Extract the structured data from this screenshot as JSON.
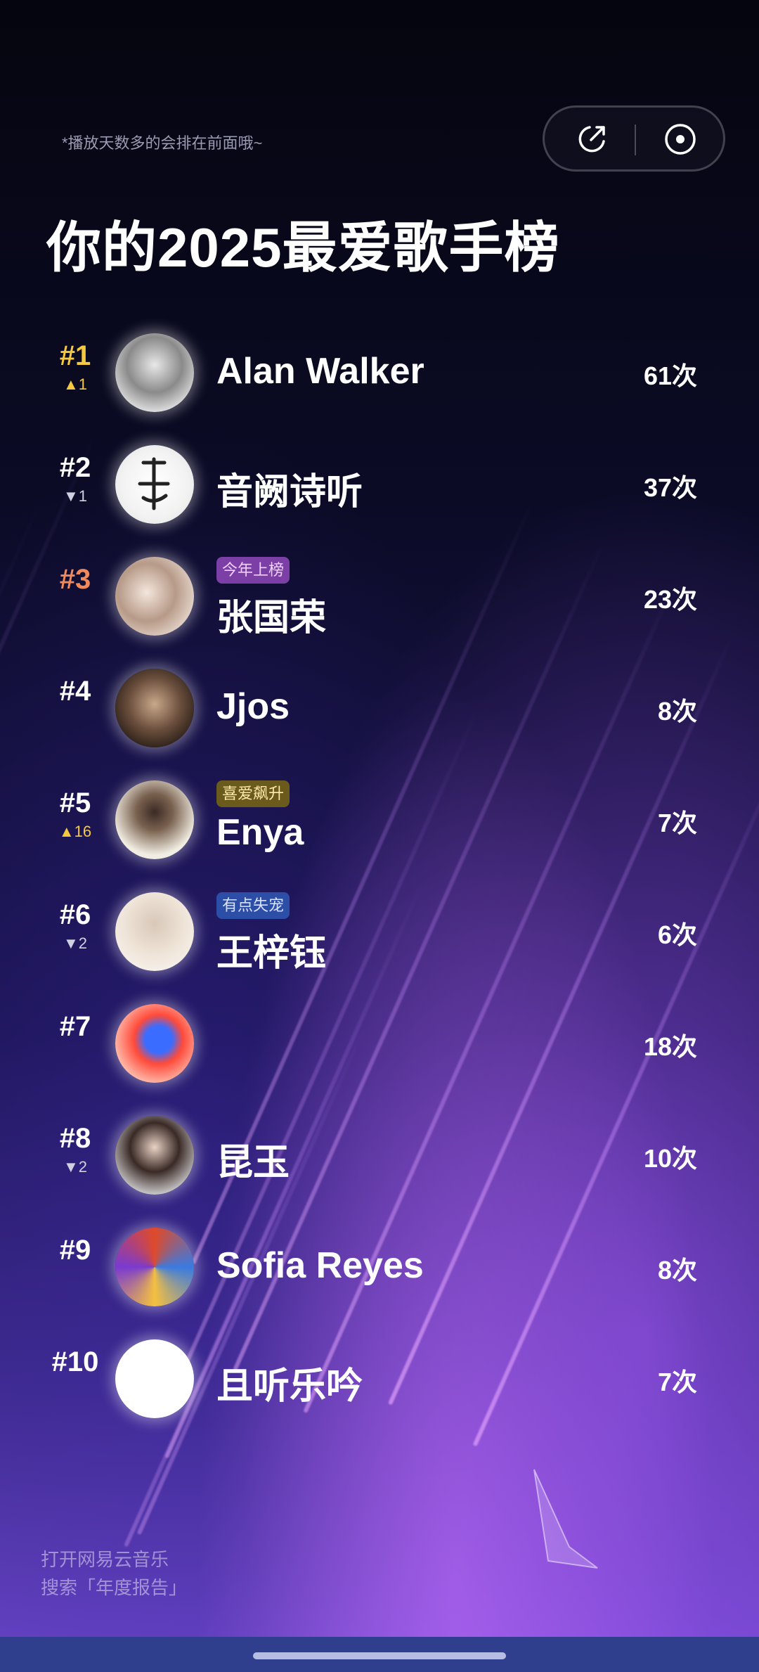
{
  "header": {
    "tip": "*播放天数多的会排在前面哦~",
    "title": "你的2025最爱歌手榜"
  },
  "actions": {
    "share_icon": "share-icon",
    "record_icon": "record-icon"
  },
  "colors": {
    "rank1": "#f5c842",
    "rank3": "#f08a5d",
    "default": "#ffffff",
    "badge_new_bg": "#7b3fa6",
    "badge_up_bg": "#6a5a1c",
    "badge_down_bg": "#2d4ea6"
  },
  "artists": [
    {
      "rank": "#1",
      "change": "▲1",
      "name": "Alan Walker",
      "count": "61次",
      "badge": ""
    },
    {
      "rank": "#2",
      "change": "▼1",
      "name": "音阙诗听",
      "count": "37次",
      "badge": ""
    },
    {
      "rank": "#3",
      "change": "",
      "name": "张国荣",
      "count": "23次",
      "badge": "今年上榜"
    },
    {
      "rank": "#4",
      "change": "",
      "name": "Jjos",
      "count": "8次",
      "badge": ""
    },
    {
      "rank": "#5",
      "change": "▲16",
      "name": "Enya",
      "count": "7次",
      "badge": "喜爱飙升"
    },
    {
      "rank": "#6",
      "change": "▼2",
      "name": "王梓钰",
      "count": "6次",
      "badge": "有点失宠"
    },
    {
      "rank": "#7",
      "change": "",
      "name": "",
      "count": "18次",
      "badge": ""
    },
    {
      "rank": "#8",
      "change": "▼2",
      "name": "昆玉",
      "count": "10次",
      "badge": ""
    },
    {
      "rank": "#9",
      "change": "",
      "name": "Sofia Reyes",
      "count": "8次",
      "badge": ""
    },
    {
      "rank": "#10",
      "change": "",
      "name": "且听乐吟",
      "count": "7次",
      "badge": ""
    }
  ],
  "footer": {
    "line1": "打开网易云音乐",
    "line2": "搜索「年度报告」"
  }
}
